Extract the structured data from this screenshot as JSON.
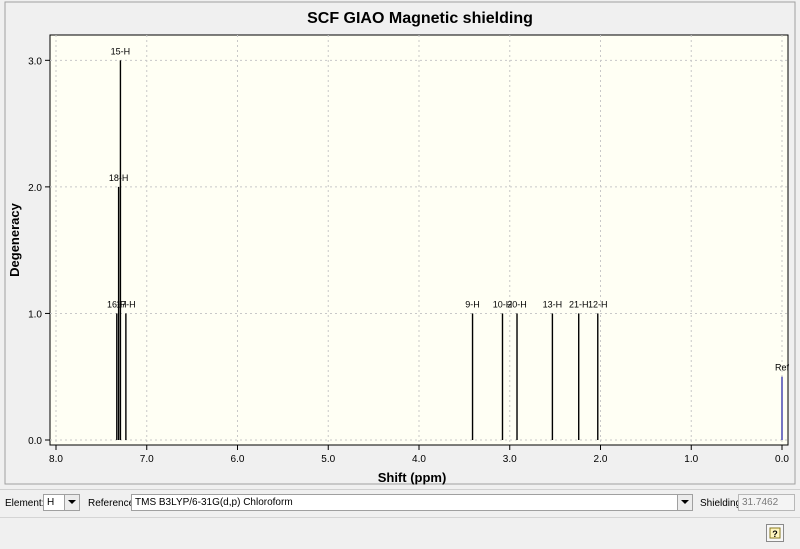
{
  "chart_data": {
    "type": "stick",
    "title": "SCF GIAO Magnetic shielding",
    "xlabel": "Shift (ppm)",
    "ylabel": "Degeneracy",
    "xlim": [
      8.0,
      0.0
    ],
    "ylim": [
      0.0,
      3.2
    ],
    "x_reversed": true,
    "x_ticks": [
      "8.0",
      "7.0",
      "6.0",
      "5.0",
      "4.0",
      "3.0",
      "2.0",
      "1.0",
      "0.0"
    ],
    "y_ticks": [
      "0.0",
      "1.0",
      "2.0",
      "3.0"
    ],
    "grid": true,
    "peaks": [
      {
        "label": "15-H",
        "shift": 7.29,
        "degeneracy": 3
      },
      {
        "label": "18-H",
        "shift": 7.31,
        "degeneracy": 2
      },
      {
        "label": "16-H",
        "shift": 7.33,
        "degeneracy": 1
      },
      {
        "label": "17-H",
        "shift": 7.23,
        "degeneracy": 1
      },
      {
        "label": "9-H",
        "shift": 3.41,
        "degeneracy": 1
      },
      {
        "label": "10-H",
        "shift": 3.08,
        "degeneracy": 1
      },
      {
        "label": "20-H",
        "shift": 2.92,
        "degeneracy": 1
      },
      {
        "label": "13-H",
        "shift": 2.53,
        "degeneracy": 1
      },
      {
        "label": "21-H",
        "shift": 2.24,
        "degeneracy": 1
      },
      {
        "label": "12-H",
        "shift": 2.03,
        "degeneracy": 1
      }
    ],
    "reference": {
      "label": "Ref",
      "shift": 0.0,
      "degeneracy": 0.5,
      "color": "#3a3ab0"
    },
    "peak_color": "#000000"
  },
  "controls": {
    "element_label": "Element:",
    "element_value": "H",
    "reference_label": "Reference:",
    "reference_value": "TMS B3LYP/6-31G(d,p) Chloroform",
    "shielding_label": "Shielding:",
    "shielding_value": "31.7462"
  }
}
